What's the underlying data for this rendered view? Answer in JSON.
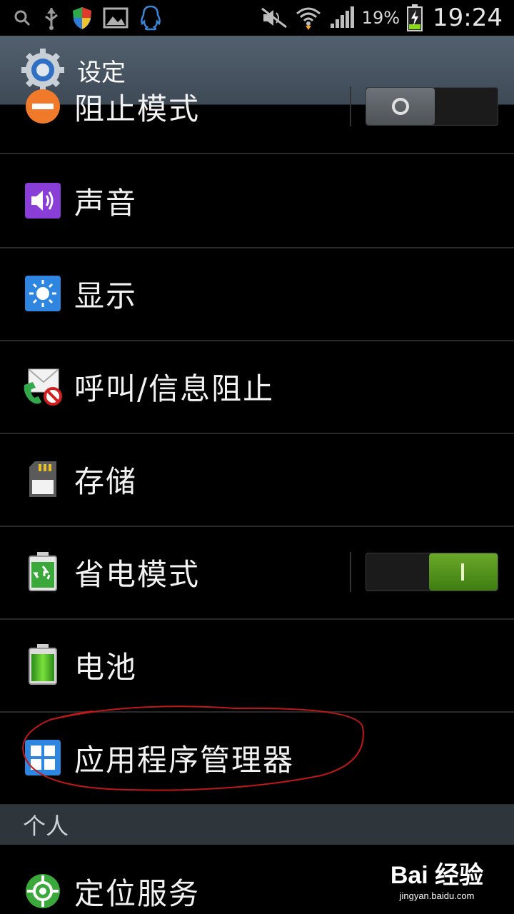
{
  "status_bar": {
    "battery_percent": "19%",
    "time": "19:24",
    "icons": [
      "search-icon",
      "usb-icon",
      "shield-icon",
      "image-icon",
      "qq-icon",
      "mute-icon",
      "wifi-icon",
      "signal-icon",
      "battery-charging-icon"
    ]
  },
  "action_bar": {
    "title": "设定",
    "icon": "gear-icon"
  },
  "items": [
    {
      "label": "阻止模式",
      "icon": "block-mode-icon",
      "toggle": {
        "on": false
      }
    },
    {
      "label": "声音",
      "icon": "speaker-icon"
    },
    {
      "label": "显示",
      "icon": "display-brightness-icon"
    },
    {
      "label": "呼叫/信息阻止",
      "icon": "call-message-block-icon"
    },
    {
      "label": "存储",
      "icon": "sd-card-icon"
    },
    {
      "label": "省电模式",
      "icon": "power-saving-icon",
      "toggle": {
        "on": true
      }
    },
    {
      "label": "电池",
      "icon": "battery-icon"
    },
    {
      "label": "应用程序管理器",
      "icon": "app-grid-icon",
      "highlighted": true
    }
  ],
  "section": {
    "label": "个人"
  },
  "personal_items": [
    {
      "label": "定位服务",
      "icon": "location-icon"
    }
  ],
  "watermark": {
    "brand": "Bai 经验",
    "site": "jingyan.baidu.com"
  },
  "colors": {
    "action_bar": "#4a5662",
    "toggle_on": "#5a9a22",
    "highlight_circle": "#c01818"
  }
}
